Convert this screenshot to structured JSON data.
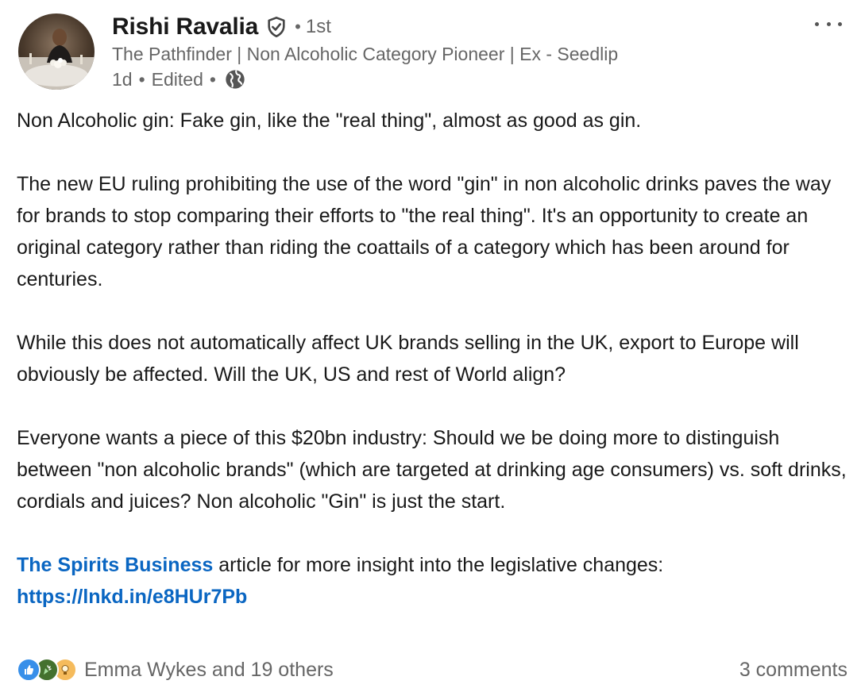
{
  "author": {
    "name": "Rishi Ravalia",
    "degree": "1st",
    "separator": "•",
    "headline": "The Pathfinder | Non Alcoholic Category Pioneer | Ex - Seedlip",
    "time": "1d",
    "edited": "Edited",
    "visibility_icon": "globe-icon",
    "verified_icon": "verified-shield-icon"
  },
  "menu": {
    "icon": "more-horizontal-icon"
  },
  "post": {
    "p1": "Non Alcoholic gin: Fake gin, like the \"real thing\", almost as good as gin.",
    "p2": "The new EU ruling prohibiting the use of the word \"gin\" in non alcoholic drinks paves the way for brands to stop comparing their efforts to \"the real thing\". It's an opportunity to create an original category rather than riding the coattails of a category which has been around for centuries.",
    "p3": "While this does not automatically affect UK brands selling in the UK, export to Europe will obviously be affected. Will the UK, US and rest of World align?",
    "p4": "Everyone wants a piece of this $20bn industry: Should we be doing more to distinguish between \"non alcoholic brands\" (which are targeted at drinking age consumers) vs. soft drinks, cordials and juices? Non alcoholic \"Gin\" is just the start.",
    "p5_link": "The Spirits Business",
    "p5_text": " article for more insight into the legislative changes:",
    "url": "https://lnkd.in/e8HUr7Pb"
  },
  "social": {
    "reaction_icons": [
      "like-icon",
      "celebrate-icon",
      "insightful-icon"
    ],
    "reactions_text": "Emma Wykes and 19 others",
    "comments_text": "3 comments"
  },
  "colors": {
    "link": "#0a66c2",
    "secondary_text": "#666666",
    "like": "#378fe9",
    "celebrate": "#44712e",
    "insightful": "#f5bb5c"
  }
}
